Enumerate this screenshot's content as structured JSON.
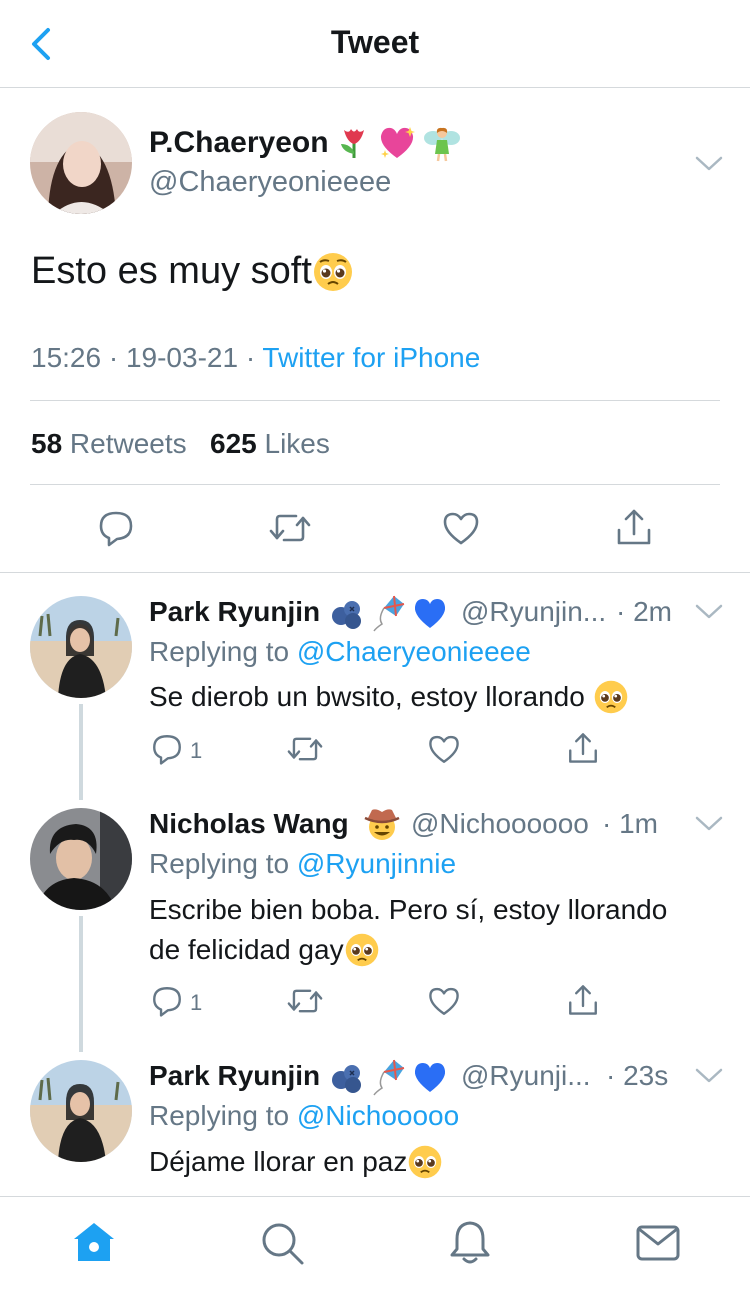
{
  "header": {
    "title": "Tweet"
  },
  "main_tweet": {
    "name": "P.Chaeryeon",
    "name_emojis": [
      "tulip-emoji",
      "sparkling-heart-emoji",
      "fairy-emoji"
    ],
    "handle": "@Chaeryeonieeee",
    "text": "Esto es muy soft",
    "text_emoji": "pleading-face-emoji",
    "time": "15:26 · 19-03-21 · ",
    "source": "Twitter for iPhone",
    "retweets_count": "58",
    "retweets_label": " Retweets",
    "likes_count": "625",
    "likes_label": " Likes"
  },
  "replies": [
    {
      "name": "Park Ryunjin",
      "name_emojis": [
        "blueberries-emoji",
        "kite-emoji",
        "blue-heart-emoji"
      ],
      "handle": "@Ryunjin...",
      "time": "· 2m",
      "replying_prefix": "Replying to ",
      "replying_to": "@Chaeryeonieeee",
      "text": "Se dierob un bwsito, estoy llorando ",
      "text_emoji": "pleading-face-emoji",
      "reply_count": "1"
    },
    {
      "name": "Nicholas Wang",
      "name_emojis": [
        "cowboy-hat-face-emoji"
      ],
      "handle": "@Nichoooooo",
      "time": "· 1m",
      "replying_prefix": "Replying to ",
      "replying_to": "@Ryunjinnie",
      "text_line1": "Escribe bien boba. Pero sí, estoy llorando",
      "text_line2": "de felicidad gay",
      "text_emoji": "pleading-face-emoji",
      "reply_count": "1"
    },
    {
      "name": "Park Ryunjin",
      "name_emojis": [
        "blueberries-emoji",
        "kite-emoji",
        "blue-heart-emoji"
      ],
      "handle": "@Ryunji...",
      "time": "· 23s",
      "replying_prefix": "Replying to ",
      "replying_to": "@Nichooooo",
      "text": "Déjame llorar en paz",
      "text_emoji": "pleading-face-emoji"
    }
  ],
  "tabbar": [
    "home-icon",
    "search-icon",
    "notifications-icon",
    "messages-icon"
  ],
  "colors": {
    "accent": "#1da1f2",
    "secondary_text": "#657786",
    "divider": "#d5d9dc"
  }
}
